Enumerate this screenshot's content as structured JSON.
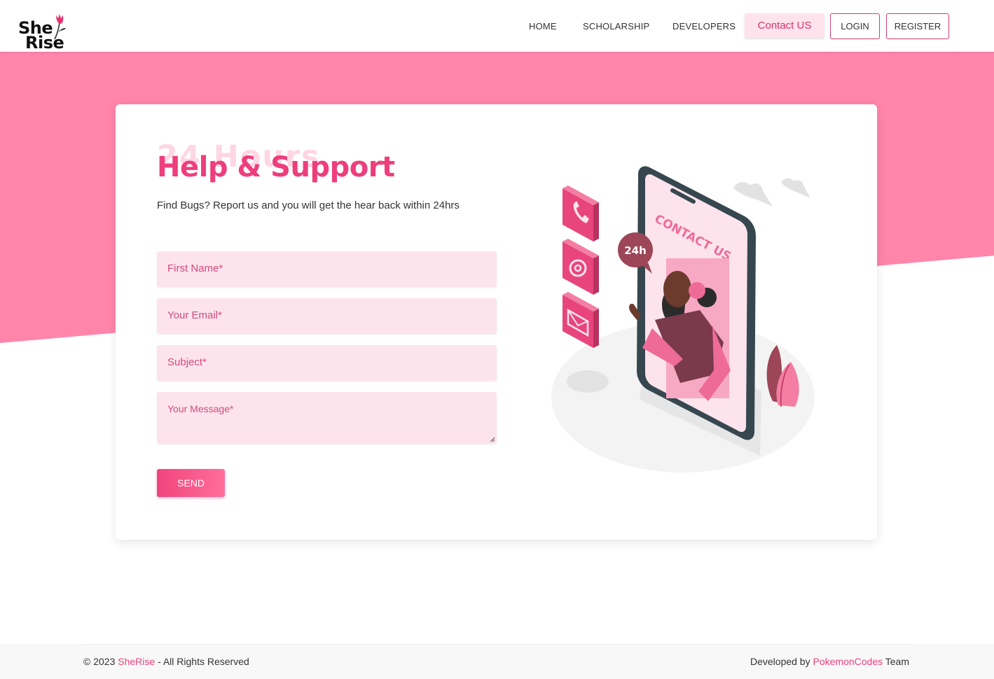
{
  "brand": {
    "logo_text_line1": "She",
    "logo_text_line2": "Rise",
    "accent_color": "#ee3e7c",
    "hero_color": "#ff85ab"
  },
  "nav": {
    "links": [
      "HOME",
      "SCHOLARSHIP",
      "DEVELOPERS"
    ],
    "contact_label": "Contact US",
    "login_label": "LOGIN",
    "register_label": "REGISTER"
  },
  "support": {
    "background_heading": "24 Hours",
    "heading": "Help & Support",
    "subtitle": "Find Bugs? Report us and you will get the hear back within 24hrs"
  },
  "form": {
    "first_name_placeholder": "First Name*",
    "email_placeholder": "Your Email*",
    "subject_placeholder": "Subject*",
    "message_placeholder": "Your Message*",
    "send_label": "SEND"
  },
  "illustration": {
    "phone_screen_text": "CONTACT US",
    "bubble_text": "24h",
    "icons": [
      "phone-icon",
      "at-icon",
      "envelope-icon"
    ]
  },
  "footer": {
    "copyright_prefix": "© 2023 ",
    "copyright_brand": "SheRise",
    "copyright_suffix": " - All Rights Reserved",
    "developed_prefix": "Developed by ",
    "developer_name": "PokemonCodes",
    "developed_suffix": " Team"
  }
}
